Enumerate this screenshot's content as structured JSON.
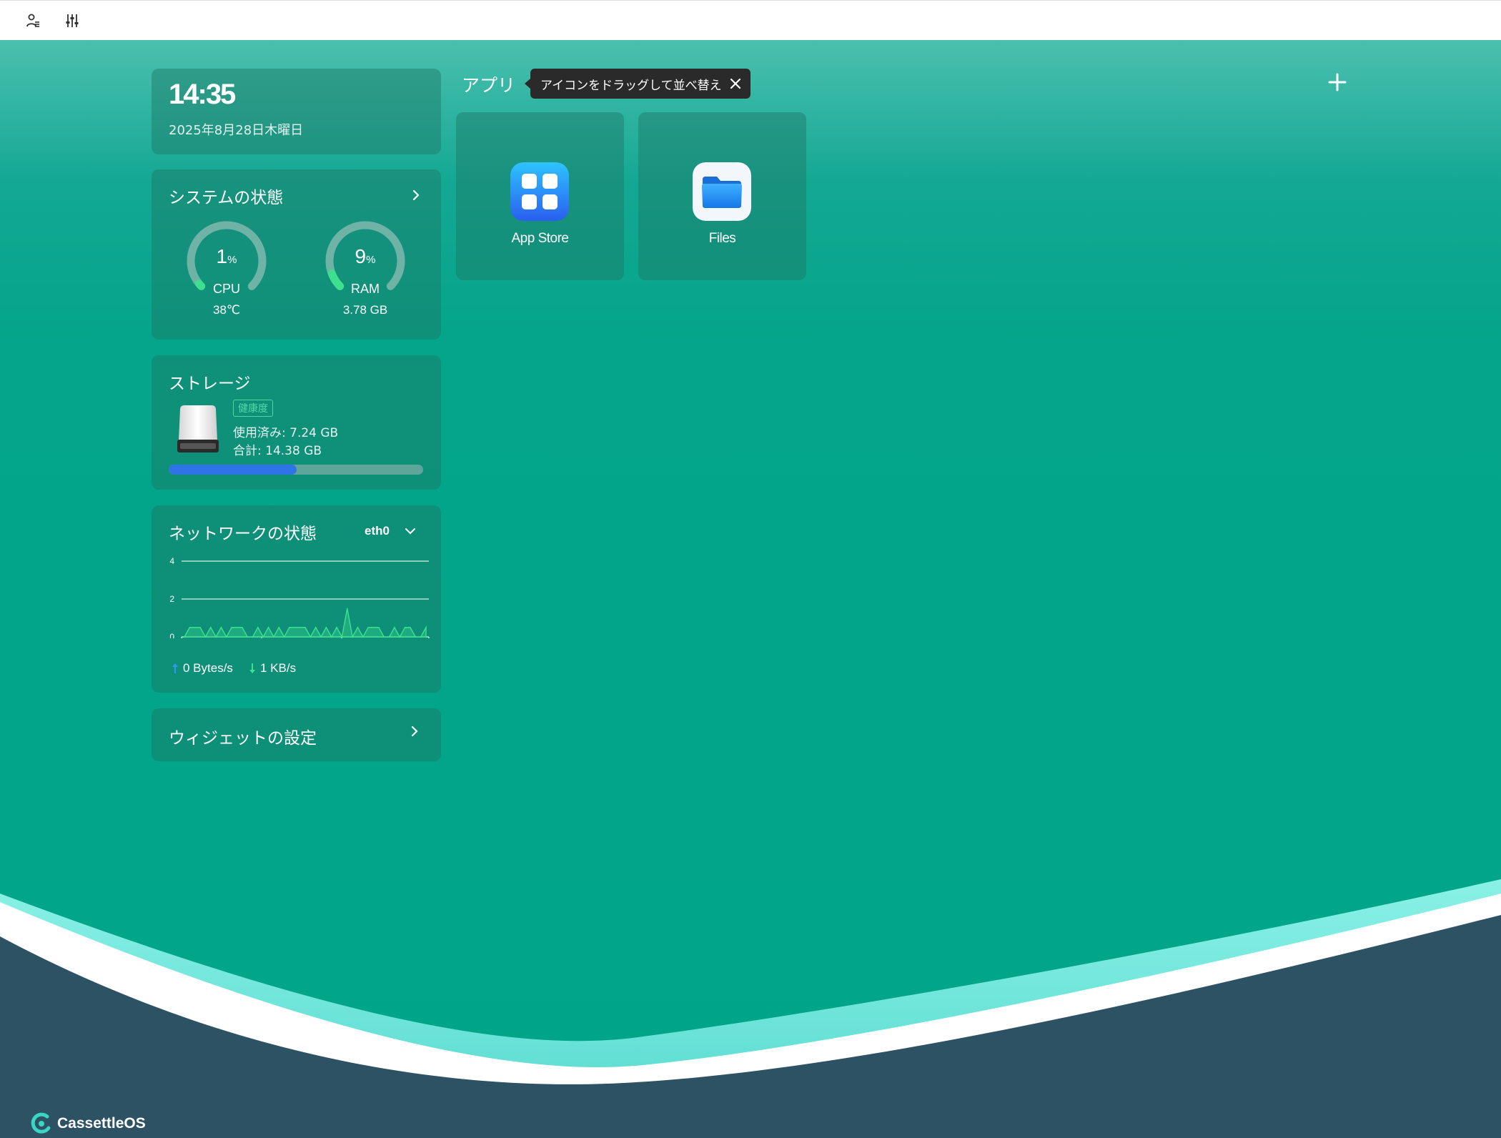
{
  "clock": {
    "time": "14:35",
    "date": "2025年8月28日木曜日"
  },
  "system": {
    "title": "システムの状態",
    "cpu": {
      "value": "1",
      "unit": "%",
      "label": "CPU",
      "sub": "38℃",
      "fraction": 0.01
    },
    "ram": {
      "value": "9",
      "unit": "%",
      "label": "RAM",
      "sub": "3.78 GB",
      "fraction": 0.09
    }
  },
  "storage": {
    "title": "ストレージ",
    "badge": "健康度",
    "used": "使用済み: 7.24 GB",
    "total": "合計: 14.38 GB",
    "used_fraction": 0.5035
  },
  "network": {
    "title": "ネットワークの状態",
    "interface": "eth0",
    "upload": "0 Bytes/s",
    "download": "1 KB/s"
  },
  "chart_data": {
    "type": "area",
    "title": "",
    "xlabel": "",
    "ylabel": "",
    "ylim": [
      0,
      4
    ],
    "yticks": [
      "0",
      "2",
      "4"
    ],
    "series": [
      {
        "values": [
          0,
          1,
          1,
          1,
          0,
          1,
          0,
          1,
          0,
          1,
          1,
          1,
          0,
          0,
          1,
          0,
          1,
          0,
          1,
          0,
          1,
          1,
          1,
          1,
          0,
          1,
          0,
          1,
          0,
          1,
          0,
          3,
          0,
          1,
          0,
          1,
          1,
          1,
          0,
          0,
          1,
          0,
          1,
          1,
          0,
          0,
          1
        ]
      }
    ]
  },
  "widgets": {
    "title": "ウィジェットの設定"
  },
  "apps": {
    "title": "アプリ",
    "tooltip": "アイコンをドラッグして並べ替え",
    "items": [
      {
        "name": "App Store",
        "icon": "app-store-icon"
      },
      {
        "name": "Files",
        "icon": "folder-icon"
      }
    ]
  },
  "brand": {
    "name": "CassettleOS"
  },
  "colors": {
    "background": "#00a68b",
    "card": "rgba(28,120,100,0.45)",
    "gauge_active": "#3ee08f",
    "gauge_track": "#6fb3a7",
    "progress_fill": "#2f74e6",
    "wave_dark": "#2d5264",
    "wave_light": "#74e6dc"
  }
}
